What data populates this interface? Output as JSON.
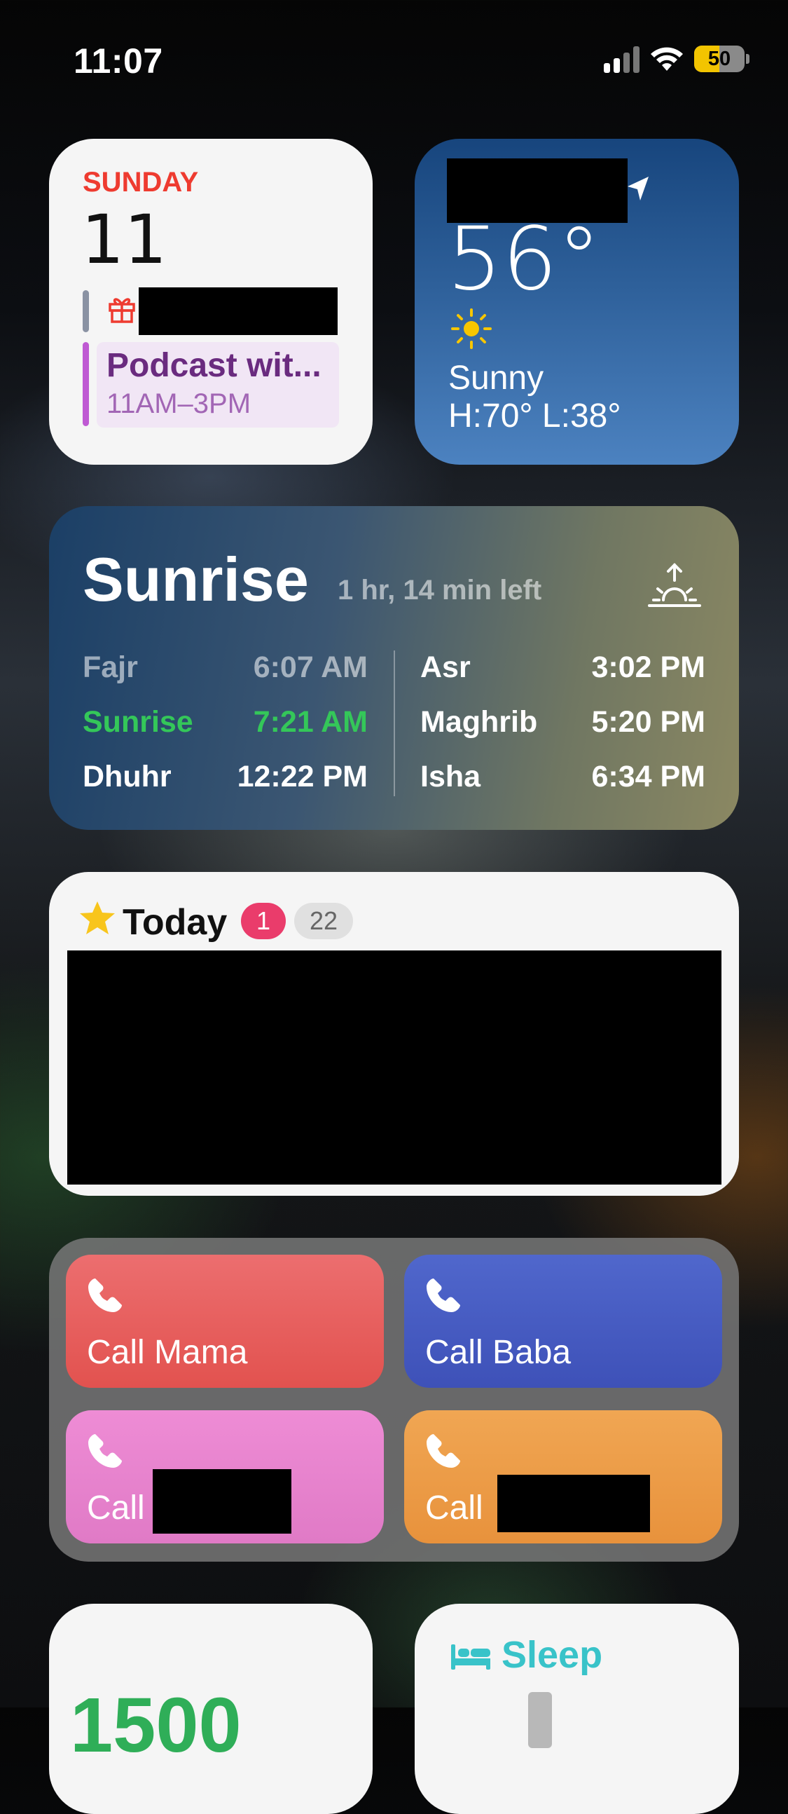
{
  "status_bar": {
    "time": "11:07",
    "battery_level": "50",
    "battery_fill_percent": 50
  },
  "calendar_widget": {
    "day": "SUNDAY",
    "date": "11",
    "event_title": "Podcast wit...",
    "event_time": "11AM–3PM"
  },
  "weather_widget": {
    "temperature": "56°",
    "condition": "Sunny",
    "high_low": "H:70° L:38°"
  },
  "prayer_widget": {
    "title": "Sunrise",
    "time_left": "1 hr, 14 min left",
    "highlight_color": "#34c759",
    "left_column": [
      {
        "name": "Fajr",
        "time": "6:07 AM",
        "state": "past"
      },
      {
        "name": "Sunrise",
        "time": "7:21 AM",
        "state": "current"
      },
      {
        "name": "Dhuhr",
        "time": "12:22 PM",
        "state": "upcoming"
      }
    ],
    "right_column": [
      {
        "name": "Asr",
        "time": "3:02 PM"
      },
      {
        "name": "Maghrib",
        "time": "5:20 PM"
      },
      {
        "name": "Isha",
        "time": "6:34 PM"
      }
    ]
  },
  "today_widget": {
    "label": "Today",
    "badge_overdue": "1",
    "badge_count": "22"
  },
  "shortcuts_widget": {
    "buttons": [
      {
        "label": "Call Mama",
        "color": "#e8575a"
      },
      {
        "label": "Call Baba",
        "color": "#4559c2"
      },
      {
        "label": "Call",
        "color": "#e682cc"
      },
      {
        "label": "Call",
        "color": "#ec9944"
      }
    ]
  },
  "steps_widget": {
    "value": "1500"
  },
  "sleep_widget": {
    "label": "Sleep"
  }
}
